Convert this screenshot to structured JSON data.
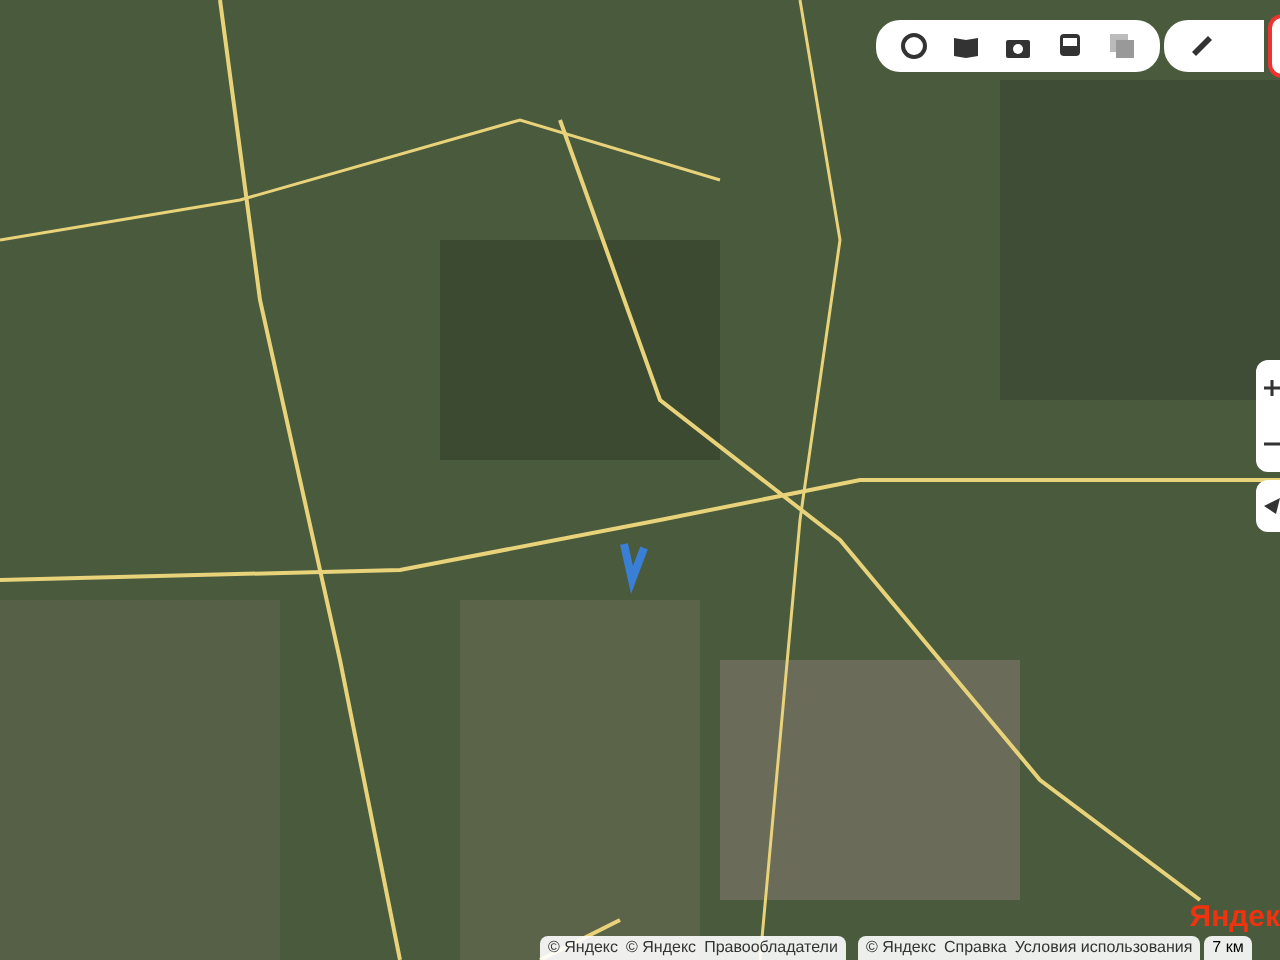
{
  "attribution_left": [
    "© Яндекс",
    "© Яндекс",
    "Правообладатели"
  ],
  "attribution_right": [
    "© Яндекс",
    "Справка",
    "Условия использования"
  ],
  "scale": "7 км",
  "logo": "Яндек"
}
